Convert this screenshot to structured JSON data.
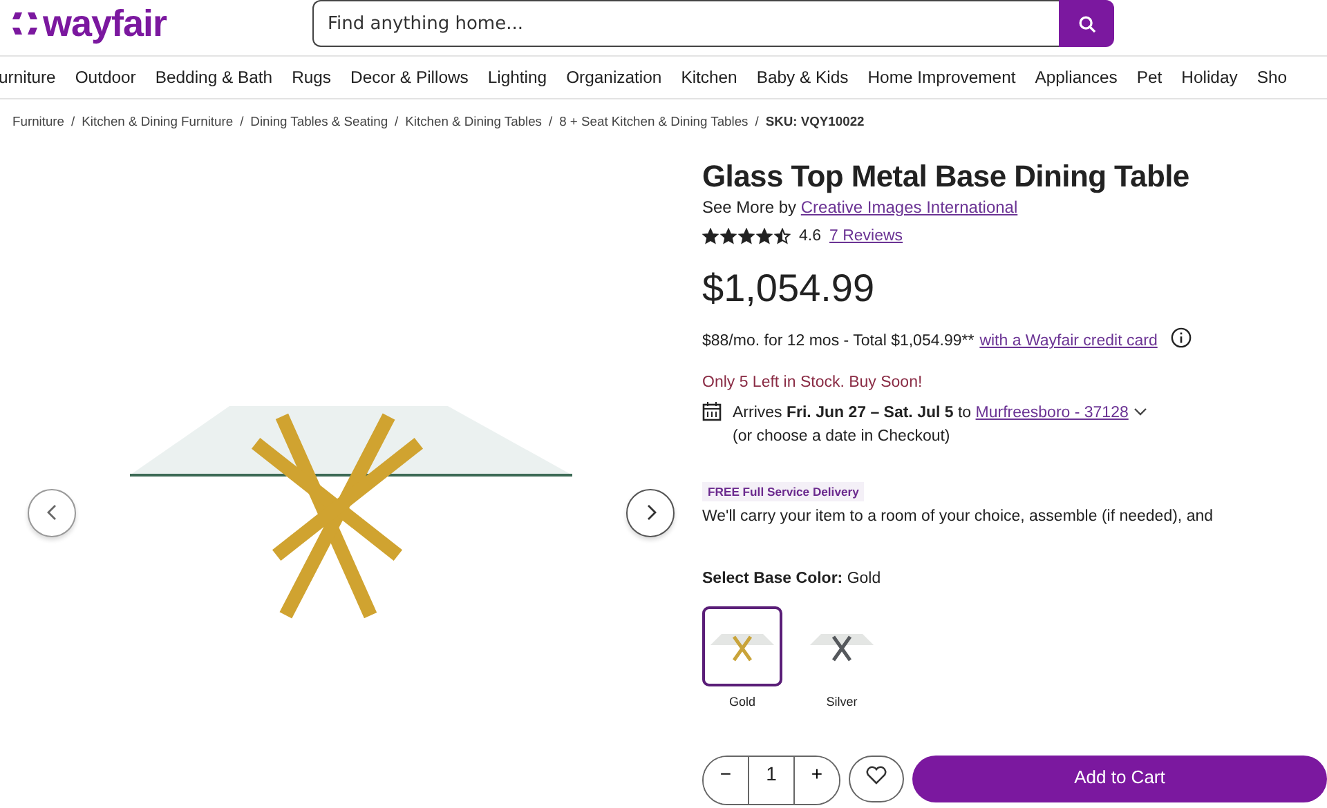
{
  "header": {
    "logo": "wayfair",
    "search": {
      "placeholder": "Find anything home..."
    }
  },
  "nav": [
    "urniture",
    "Outdoor",
    "Bedding & Bath",
    "Rugs",
    "Decor & Pillows",
    "Lighting",
    "Organization",
    "Kitchen",
    "Baby & Kids",
    "Home Improvement",
    "Appliances",
    "Pet",
    "Holiday",
    "Sho"
  ],
  "breadcrumbs": [
    "Furniture",
    "Kitchen & Dining Furniture",
    "Dining Tables & Seating",
    "Kitchen & Dining Tables",
    "8 + Seat Kitchen & Dining Tables"
  ],
  "breadcrumb_separator": "/",
  "sku": "SKU: VQY10022",
  "product": {
    "title": "Glass Top Metal Base Dining Table",
    "see_more": "See More by",
    "brand": "Creative Images International",
    "stars": 4.5,
    "rating": "4.6",
    "reviews": "7 Reviews",
    "price": "$1,054.99",
    "financing": "$88/mo. for 12 mos - Total $1,054.99**",
    "financing_link": "with a Wayfair credit card",
    "stock": "Only 5 Left in Stock. Buy Soon!",
    "arrival": "Arrives **Fri. Jun 27 – Sat. Jul 5** to",
    "location": "Murfreesboro - 37128",
    "arrival_note": "(or choose a date in Checkout)",
    "service_badge": "FREE Full Service Delivery",
    "service_text": "We'll carry your item to a room of your choice, assemble (if needed), and",
    "color_label": "Select Base Color:",
    "color_value": "Gold",
    "swatches": [
      {
        "label": "Gold",
        "selected": true,
        "color": "#c9a43a"
      },
      {
        "label": "Silver",
        "selected": false,
        "color": "#55585c"
      }
    ],
    "quantity": "1",
    "minus": "−",
    "plus": "+",
    "cart_button": "Add to Cart"
  }
}
